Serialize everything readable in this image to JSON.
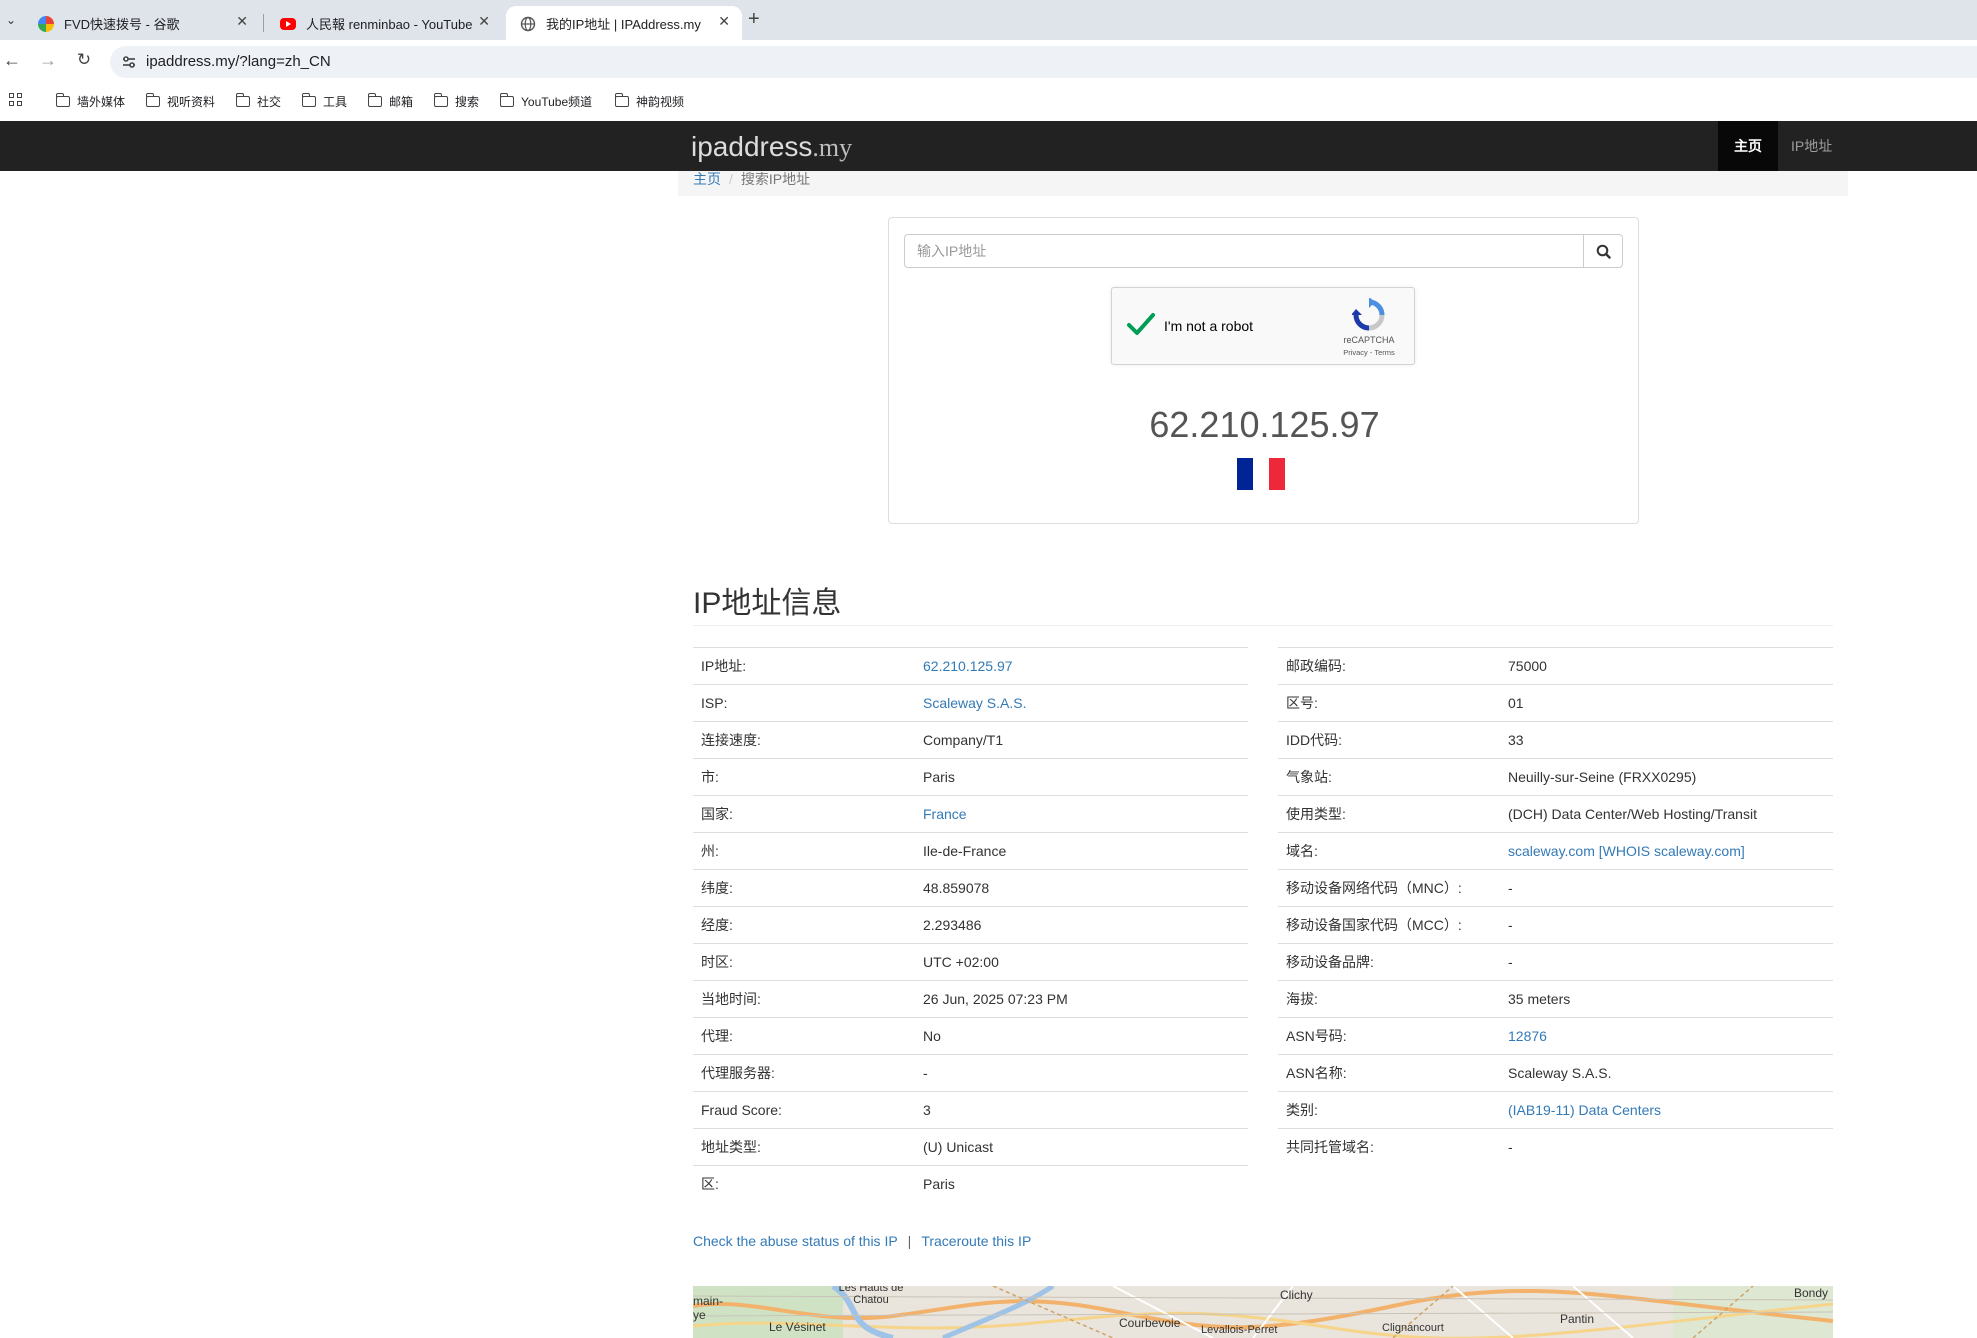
{
  "browser": {
    "tabs": [
      {
        "title": "FVD快速拨号 - 谷歌",
        "close": "✕"
      },
      {
        "title": "人民報 renminbao - YouTube",
        "close": "✕"
      },
      {
        "title": "我的IP地址 | IPAddress.my",
        "close": "✕"
      }
    ],
    "new_tab": "+",
    "url": "ipaddress.my/?lang=zh_CN",
    "bookmarks": [
      "墙外媒体",
      "视听资料",
      "社交",
      "工具",
      "邮箱",
      "搜索",
      "YouTube频道",
      "神韵视频"
    ]
  },
  "site": {
    "brand_main": "ipaddress",
    "brand_tld": ".my",
    "nav": [
      "主页",
      "IP地址"
    ]
  },
  "breadcrumb": {
    "home": "主页",
    "current": "搜索IP地址"
  },
  "search": {
    "placeholder": "输入IP地址",
    "recaptcha_label": "I'm not a robot",
    "recaptcha_brand": "reCAPTCHA",
    "recaptcha_terms": "Privacy - Terms"
  },
  "ip_display": "62.210.125.97",
  "colors": {
    "flag_blue": "#002395",
    "flag_white": "#ffffff",
    "flag_red": "#ed2939",
    "link": "#337ab7",
    "navbar": "#222222"
  },
  "section_title": "IP地址信息",
  "info_left": [
    {
      "k": "IP地址:",
      "v": "62.210.125.97",
      "link": true
    },
    {
      "k": "ISP:",
      "v": "Scaleway S.A.S.",
      "link": true
    },
    {
      "k": "连接速度:",
      "v": "Company/T1",
      "link": false
    },
    {
      "k": "市:",
      "v": "Paris",
      "link": false
    },
    {
      "k": "国家:",
      "v": "France",
      "link": true
    },
    {
      "k": "州:",
      "v": "Ile-de-France",
      "link": false
    },
    {
      "k": "纬度:",
      "v": "48.859078",
      "link": false
    },
    {
      "k": "经度:",
      "v": "2.293486",
      "link": false
    },
    {
      "k": "时区:",
      "v": "UTC +02:00",
      "link": false
    },
    {
      "k": "当地时间:",
      "v": "26 Jun, 2025 07:23 PM",
      "link": false
    },
    {
      "k": "代理:",
      "v": "No",
      "link": false
    },
    {
      "k": "代理服务器:",
      "v": "-",
      "link": false
    },
    {
      "k": "Fraud Score:",
      "v": "3",
      "link": false
    },
    {
      "k": "地址类型:",
      "v": "(U) Unicast",
      "link": false
    },
    {
      "k": "区:",
      "v": "Paris",
      "link": false
    }
  ],
  "info_right": [
    {
      "k": "邮政编码:",
      "v": "75000",
      "link": false
    },
    {
      "k": "区号:",
      "v": "01",
      "link": false
    },
    {
      "k": "IDD代码:",
      "v": "33",
      "link": false
    },
    {
      "k": "气象站:",
      "v": "Neuilly-sur-Seine (FRXX0295)",
      "link": false
    },
    {
      "k": "使用类型:",
      "v": "(DCH) Data Center/Web Hosting/Transit",
      "link": false
    },
    {
      "k": "域名:",
      "v": "scaleway.com [WHOIS scaleway.com]",
      "link": true
    },
    {
      "k": "移动设备网络代码（MNC）:",
      "v": "-",
      "link": false
    },
    {
      "k": "移动设备国家代码（MCC）:",
      "v": "-",
      "link": false
    },
    {
      "k": "移动设备品牌:",
      "v": "-",
      "link": false
    },
    {
      "k": "海拔:",
      "v": "35 meters",
      "link": false
    },
    {
      "k": "ASN号码:",
      "v": "12876",
      "link": true
    },
    {
      "k": "ASN名称:",
      "v": "Scaleway S.A.S.",
      "link": false
    },
    {
      "k": "类别:",
      "v": "(IAB19-11) Data Centers",
      "link": true
    },
    {
      "k": "共同托管域名:",
      "v": "-",
      "link": false
    }
  ],
  "links": {
    "abuse": "Check the abuse status of this IP",
    "separator": "|",
    "traceroute": "Traceroute this IP"
  },
  "map_labels": [
    "Les Hauts de Chatou",
    "main-ye",
    "Le Vésinet",
    "Courbevoie",
    "Levallois-Perret",
    "Clichy",
    "Clignancourt",
    "Pantin",
    "Bondy"
  ]
}
